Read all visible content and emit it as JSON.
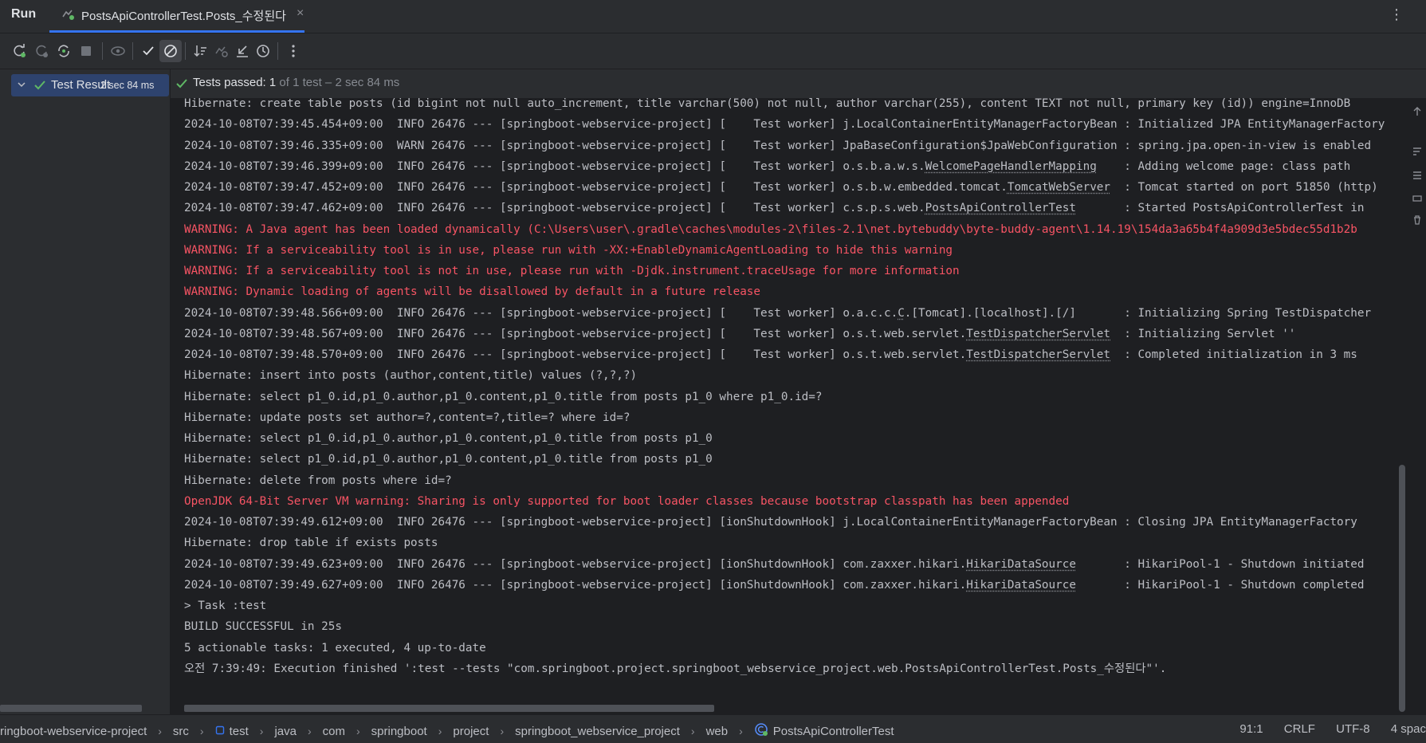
{
  "topbar": {
    "run_label": "Run",
    "tab_title": "PostsApiControllerTest.Posts_수정된다",
    "close_glyph": "×",
    "more_glyph": "⋮"
  },
  "toolbar": {
    "buttons": [
      "rerun-icon",
      "rerun-failed-icon",
      "toggle-auto-test-icon",
      "stop-icon",
      "eye-icon",
      "show-passed-icon",
      "show-ignored-icon",
      "sort-icon",
      "import-tests-icon",
      "export-icon",
      "history-icon",
      "more-icon"
    ]
  },
  "tree": {
    "label": "Test Results",
    "time": "2 sec 84 ms"
  },
  "status": {
    "bold": "Tests passed: 1",
    "dim": " of 1 test – 2 sec 84 ms"
  },
  "console": {
    "lines": [
      {
        "text": "Hibernate: create table posts (id bigint not null auto_increment, title varchar(500) not null, author varchar(255), content TEXT not null, primary key (id)) engine=InnoDB",
        "red": false
      },
      {
        "text": "2024-10-08T07:39:45.454+09:00  INFO 26476 --- [springboot-webservice-project] [    Test worker] j.LocalContainerEntityManagerFactoryBean : Initialized JPA EntityManagerFactory",
        "red": false
      },
      {
        "text": "2024-10-08T07:39:46.335+09:00  WARN 26476 --- [springboot-webservice-project] [    Test worker] JpaBaseConfiguration$JpaWebConfiguration : spring.jpa.open-in-view is enabled",
        "red": false
      },
      {
        "pre": "2024-10-08T07:39:46.399+09:00  INFO 26476 --- [springboot-webservice-project] [    Test worker] o.s.b.a.w.s.",
        "link": "WelcomePageHandlerMapping",
        "post": "    : Adding welcome page: class path",
        "red": false
      },
      {
        "pre": "2024-10-08T07:39:47.452+09:00  INFO 26476 --- [springboot-webservice-project] [    Test worker] o.s.b.w.embedded.tomcat.",
        "link": "TomcatWebServer",
        "post": "  : Tomcat started on port 51850 (http)",
        "red": false
      },
      {
        "pre": "2024-10-08T07:39:47.462+09:00  INFO 26476 --- [springboot-webservice-project] [    Test worker] c.s.p.s.web.",
        "link": "PostsApiControllerTest",
        "post": "       : Started PostsApiControllerTest in",
        "red": false
      },
      {
        "text": "WARNING: A Java agent has been loaded dynamically (C:\\Users\\user\\.gradle\\caches\\modules-2\\files-2.1\\net.bytebuddy\\byte-buddy-agent\\1.14.19\\154da3a65b4f4a909d3e5bdec55d1b2b",
        "red": true
      },
      {
        "text": "WARNING: If a serviceability tool is in use, please run with -XX:+EnableDynamicAgentLoading to hide this warning",
        "red": true
      },
      {
        "text": "WARNING: If a serviceability tool is not in use, please run with -Djdk.instrument.traceUsage for more information",
        "red": true
      },
      {
        "text": "WARNING: Dynamic loading of agents will be disallowed by default in a future release",
        "red": true
      },
      {
        "pre": "2024-10-08T07:39:48.566+09:00  INFO 26476 --- [springboot-webservice-project] [    Test worker] o.a.c.c.",
        "link": "C",
        "post": ".[Tomcat].[localhost].[/]       : Initializing Spring TestDispatcher",
        "red": false
      },
      {
        "pre": "2024-10-08T07:39:48.567+09:00  INFO 26476 --- [springboot-webservice-project] [    Test worker] o.s.t.web.servlet.",
        "link": "TestDispatcherServlet",
        "post": "  : Initializing Servlet ''",
        "red": false
      },
      {
        "pre": "2024-10-08T07:39:48.570+09:00  INFO 26476 --- [springboot-webservice-project] [    Test worker] o.s.t.web.servlet.",
        "link": "TestDispatcherServlet",
        "post": "  : Completed initialization in 3 ms",
        "red": false
      },
      {
        "text": "Hibernate: insert into posts (author,content,title) values (?,?,?)",
        "red": false
      },
      {
        "text": "Hibernate: select p1_0.id,p1_0.author,p1_0.content,p1_0.title from posts p1_0 where p1_0.id=?",
        "red": false
      },
      {
        "text": "Hibernate: update posts set author=?,content=?,title=? where id=?",
        "red": false
      },
      {
        "text": "Hibernate: select p1_0.id,p1_0.author,p1_0.content,p1_0.title from posts p1_0",
        "red": false
      },
      {
        "text": "Hibernate: select p1_0.id,p1_0.author,p1_0.content,p1_0.title from posts p1_0",
        "red": false
      },
      {
        "text": "Hibernate: delete from posts where id=?",
        "red": false
      },
      {
        "text": "OpenJDK 64-Bit Server VM warning: Sharing is only supported for boot loader classes because bootstrap classpath has been appended",
        "red": true
      },
      {
        "text": "2024-10-08T07:39:49.612+09:00  INFO 26476 --- [springboot-webservice-project] [ionShutdownHook] j.LocalContainerEntityManagerFactoryBean : Closing JPA EntityManagerFactory",
        "red": false
      },
      {
        "text": "Hibernate: drop table if exists posts",
        "red": false
      },
      {
        "pre": "2024-10-08T07:39:49.623+09:00  INFO 26476 --- [springboot-webservice-project] [ionShutdownHook] com.zaxxer.hikari.",
        "link": "HikariDataSource",
        "post": "       : HikariPool-1 - Shutdown initiated",
        "red": false
      },
      {
        "pre": "2024-10-08T07:39:49.627+09:00  INFO 26476 --- [springboot-webservice-project] [ionShutdownHook] com.zaxxer.hikari.",
        "link": "HikariDataSource",
        "post": "       : HikariPool-1 - Shutdown completed",
        "red": false
      },
      {
        "text": "> Task :test",
        "red": false
      },
      {
        "text": "BUILD SUCCESSFUL in 25s",
        "red": false
      },
      {
        "text": "5 actionable tasks: 1 executed, 4 up-to-date",
        "red": false
      },
      {
        "text": "오전 7:39:49: Execution finished ':test --tests \"com.springboot.project.springboot_webservice_project.web.PostsApiControllerTest.Posts_수정된다\"'.",
        "red": false
      }
    ]
  },
  "breadcrumb": [
    {
      "label": "ringboot-webservice-project",
      "icon": ""
    },
    {
      "label": "src",
      "icon": ""
    },
    {
      "label": "test",
      "icon": "module-icon"
    },
    {
      "label": "java",
      "icon": ""
    },
    {
      "label": "com",
      "icon": ""
    },
    {
      "label": "springboot",
      "icon": ""
    },
    {
      "label": "project",
      "icon": ""
    },
    {
      "label": "springboot_webservice_project",
      "icon": ""
    },
    {
      "label": "web",
      "icon": ""
    },
    {
      "label": "PostsApiControllerTest",
      "icon": "test-class-icon"
    }
  ],
  "status_right": {
    "position": "91:1",
    "line_sep": "CRLF",
    "encoding": "UTF-8",
    "indent": "4 spac"
  },
  "colors": {
    "accent": "#3574f0",
    "success": "#5fb865",
    "error_text": "#f75464"
  }
}
